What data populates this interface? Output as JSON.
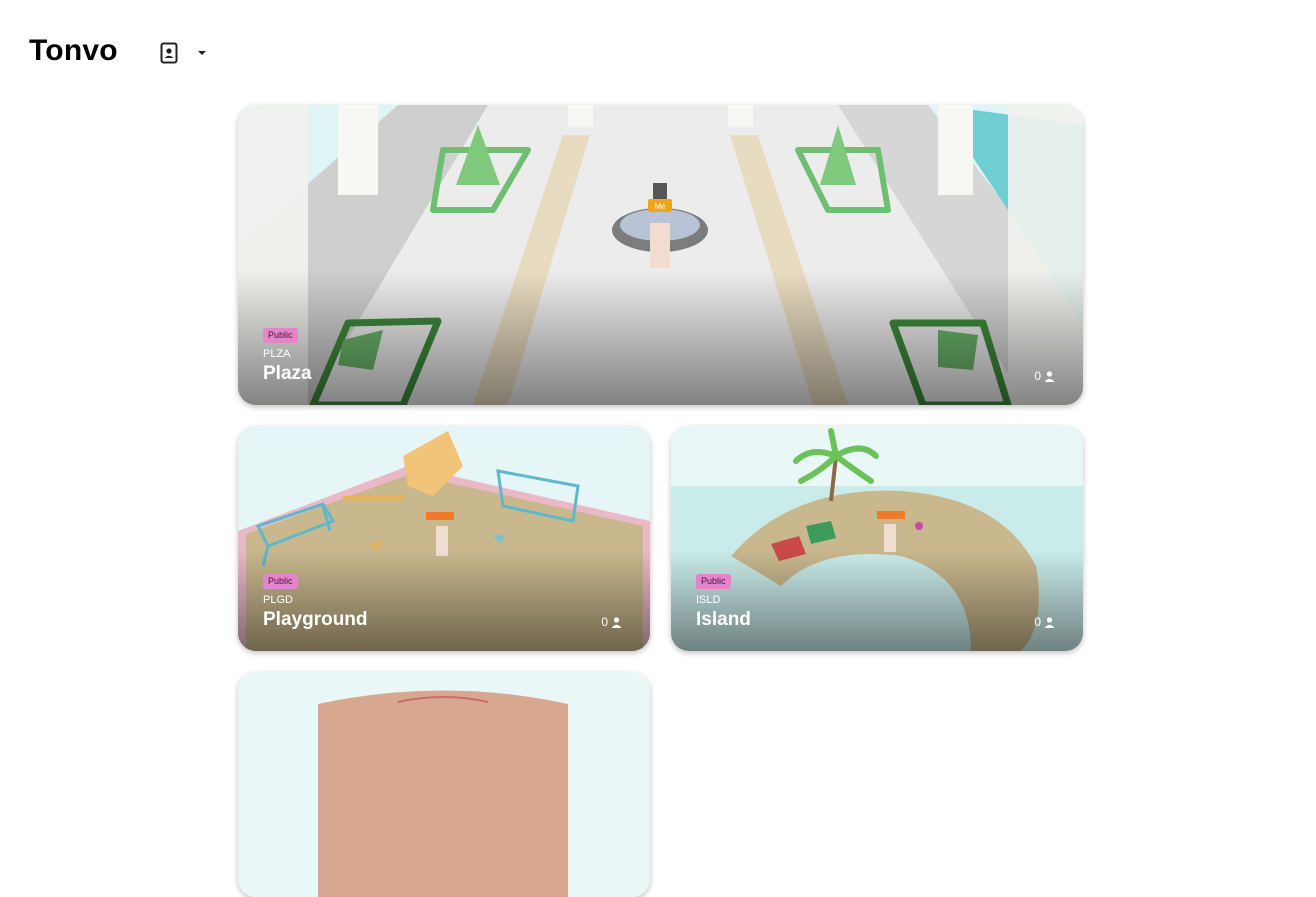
{
  "app": {
    "title": "Tonvo"
  },
  "header": {
    "account_icon": "contact-card-icon",
    "menu_icon": "caret-down-icon"
  },
  "rooms": [
    {
      "visibility": "Public",
      "code": "PLZA",
      "name": "Plaza",
      "players": "0",
      "me_label": "Me"
    },
    {
      "visibility": "Public",
      "code": "PLGD",
      "name": "Playground",
      "players": "0"
    },
    {
      "visibility": "Public",
      "code": "ISLD",
      "name": "Island",
      "players": "0"
    }
  ],
  "colors": {
    "badge": "#e585c9",
    "floor": "#ececec",
    "sky": "#bfe9ea",
    "sand": "#c9b88e"
  }
}
